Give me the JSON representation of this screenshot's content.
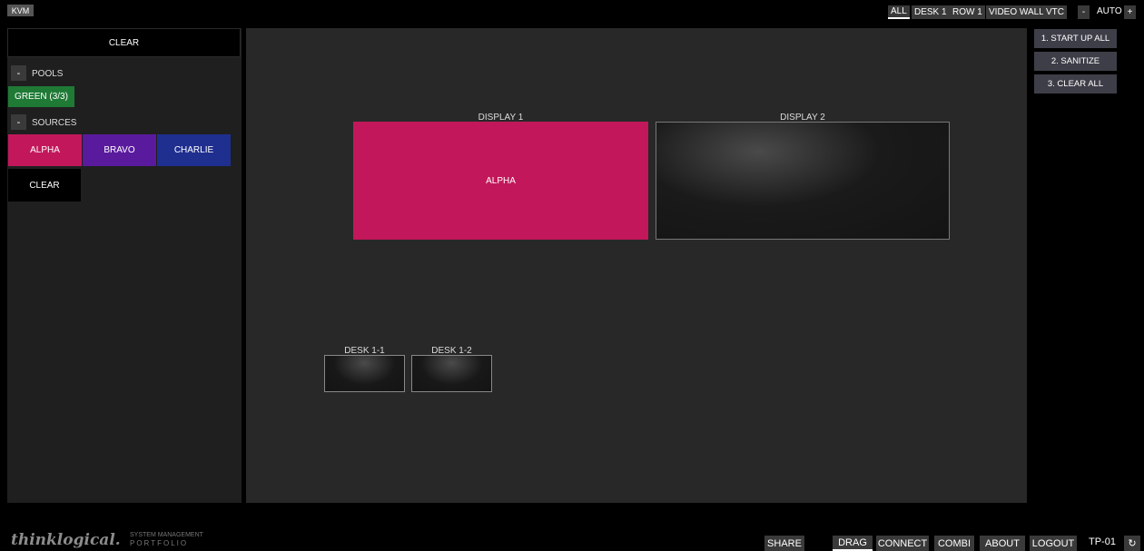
{
  "topbar": {
    "kvm": "KVM",
    "tabs": [
      {
        "label": "ALL",
        "active": true
      },
      {
        "label": "DESK 1",
        "active": false
      },
      {
        "label": "ROW 1",
        "active": false
      },
      {
        "label": "VIDEO WALL",
        "active": false
      },
      {
        "label": "VTC",
        "active": false
      }
    ],
    "zoom_minus": "-",
    "zoom_label": "AUTO",
    "zoom_plus": "+"
  },
  "left": {
    "clear_top": "CLEAR",
    "pools_toggle": "-",
    "pools_label": "POOLS",
    "pools": [
      {
        "label": "GREEN (3/3)",
        "color": "#1f7a36"
      }
    ],
    "sources_toggle": "-",
    "sources_label": "SOURCES",
    "sources": [
      {
        "label": "ALPHA",
        "color": "#c2185b"
      },
      {
        "label": "BRAVO",
        "color": "#5a1a9e"
      },
      {
        "label": "CHARLIE",
        "color": "#1f2f8f"
      }
    ],
    "clear_source": "CLEAR"
  },
  "main": {
    "display1_label": "DISPLAY 1",
    "display1_content": "ALPHA",
    "display2_label": "DISPLAY 2",
    "desk1_label": "DESK 1-1",
    "desk2_label": "DESK 1-2"
  },
  "actions": [
    "1. START UP ALL",
    "2. SANITIZE",
    "3. CLEAR ALL"
  ],
  "bottom": {
    "logo": "thinklogical.",
    "logo_sub1": "SYSTEM MANAGEMENT",
    "logo_sub2": "PORTFOLIO",
    "share": "SHARE",
    "nav": [
      "DRAG",
      "CONNECT",
      "COMBI",
      "ABOUT",
      "LOGOUT"
    ],
    "active_nav": "DRAG",
    "device": "TP-01",
    "refresh_icon": "↻"
  }
}
